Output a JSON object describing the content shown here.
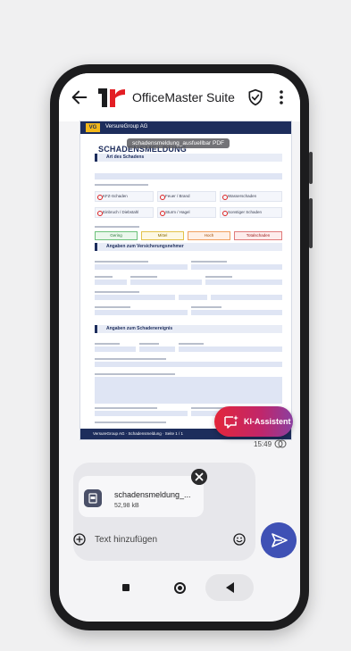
{
  "app": {
    "title": "OfficeMaster Suite"
  },
  "document": {
    "company": "VersureGroup AG",
    "logo_text": "VG",
    "title": "SCHADENSMELDUNG",
    "tooltip": "schadensmeldung_ausfuellbar PDF",
    "sections": [
      "Art des Schadens",
      "Angaben zum Versicherungsnehmer",
      "Angaben zum Schadenereignis"
    ],
    "checkboxes": [
      "KFZ-Schaden",
      "Feuer / Brand",
      "Wasserschaden",
      "Einbruch / Diebstahl",
      "Sturm / Hagel",
      "Sonstiger Schaden"
    ],
    "priorities": [
      "Gering",
      "Mittel",
      "Hoch",
      "Totalschaden"
    ],
    "footer": "VersureGroup AG · Schadensmeldung · Seite 1 / 1"
  },
  "assistant": {
    "label": "KI-Assistent"
  },
  "message": {
    "time": "15:49"
  },
  "attachment": {
    "name": "schadensmeldung_...",
    "size": "52,98 kB"
  },
  "composer": {
    "placeholder": "Text hinzufügen"
  },
  "colors": {
    "accent": "#3f51b5",
    "doc_navy": "#1d2d5c",
    "ki_gradient_start": "#e3263a",
    "ki_gradient_end": "#8a3fa0"
  }
}
